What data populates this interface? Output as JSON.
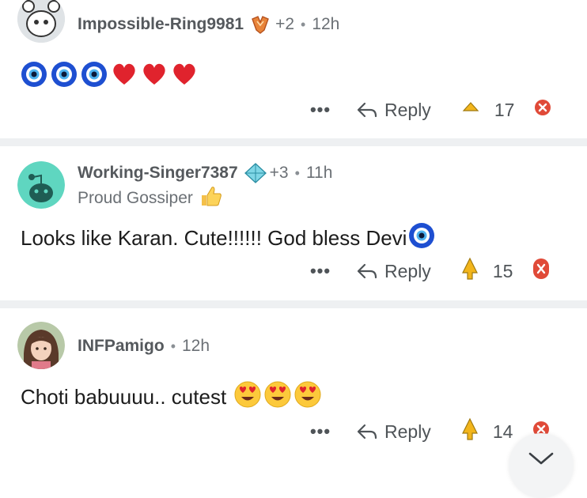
{
  "comments": [
    {
      "username": "Impossible-Ring9981",
      "award_count": "+2",
      "age": "12h",
      "flair": "",
      "text": "",
      "reply_label": "Reply",
      "score": "17",
      "more": "•••"
    },
    {
      "username": "Working-Singer7387",
      "award_count": "+3",
      "age": "11h",
      "flair": "Proud Gossiper",
      "text": "Looks like Karan. Cute!!!!!! God bless Devi",
      "reply_label": "Reply",
      "score": "15",
      "more": "•••"
    },
    {
      "username": "INFPamigo",
      "age": "12h",
      "text": "Choti babuuuu.. cutest",
      "reply_label": "Reply",
      "score": "14",
      "more": "•••"
    }
  ],
  "colors": {
    "evil_eye": "#1e4fd1",
    "heart": "#e0232d",
    "upvote": "#f2b51c",
    "downvote": "#e04a38",
    "separator": "#eef0f2"
  },
  "icons": [
    "reddit-avatar-icon",
    "award-icon",
    "reply-icon",
    "upvote-icon",
    "downvote-icon",
    "chevron-down-icon",
    "thumbs-up-icon",
    "evil-eye-icon",
    "heart-icon",
    "heart-eyes-icon"
  ]
}
